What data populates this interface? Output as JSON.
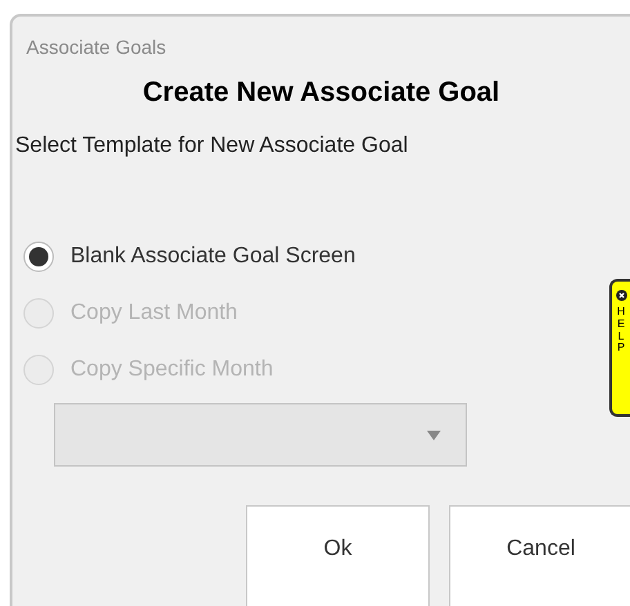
{
  "window": {
    "title": "Associate Goals"
  },
  "heading": "Create New Associate Goal",
  "prompt": "Select Template for New Associate Goal",
  "options": [
    {
      "label": "Blank Associate Goal Screen",
      "selected": true,
      "disabled": false
    },
    {
      "label": "Copy Last Month",
      "selected": false,
      "disabled": true
    },
    {
      "label": "Copy Specific Month",
      "selected": false,
      "disabled": true
    }
  ],
  "month_dropdown": {
    "disabled": true
  },
  "buttons": [
    "Ok",
    "Cancel"
  ],
  "help_tab": {
    "label": "HELP"
  }
}
